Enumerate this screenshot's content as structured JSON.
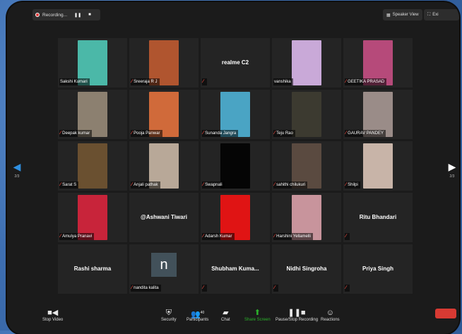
{
  "recording": {
    "label": "Recording...",
    "pause_icon": "pause-icon",
    "stop_icon": "stop-icon"
  },
  "view": {
    "speaker_view": "Speaker View",
    "exit": "Exi"
  },
  "pager": {
    "page": "2/3"
  },
  "tiles": [
    {
      "name": "Sakshi Kumari",
      "muted": false,
      "kind": "video",
      "color": "#4bb8a8"
    },
    {
      "name": "Sreeraja R J",
      "muted": true,
      "kind": "video",
      "color": "#b0552f"
    },
    {
      "name": "",
      "display": "realme C2",
      "muted": true,
      "kind": "text"
    },
    {
      "name": "vanshika",
      "muted": false,
      "kind": "video",
      "color": "#c9a9d8"
    },
    {
      "name": "GEETIKA PRASAD",
      "muted": true,
      "kind": "video",
      "color": "#b64a7a"
    },
    {
      "name": "Deepak kumar",
      "muted": true,
      "kind": "video",
      "color": "#8c8070"
    },
    {
      "name": "Pooja Panwar",
      "muted": true,
      "kind": "video",
      "color": "#d06a3a"
    },
    {
      "name": "Sunanda Jangra",
      "muted": true,
      "kind": "video",
      "color": "#4aa4c4"
    },
    {
      "name": "Teju Rao",
      "muted": true,
      "kind": "video",
      "color": "#3c3a30"
    },
    {
      "name": "GAURAV PANDEY",
      "muted": true,
      "kind": "video",
      "color": "#9a8c88"
    },
    {
      "name": "Sarat S",
      "muted": true,
      "kind": "video",
      "color": "#6a5030"
    },
    {
      "name": "Anjali pathak",
      "muted": true,
      "kind": "video",
      "color": "#b8a898"
    },
    {
      "name": "Swapnali",
      "muted": true,
      "kind": "video",
      "color": "#050505"
    },
    {
      "name": "sahithi chilukuri",
      "muted": true,
      "kind": "video",
      "color": "#5a4a40"
    },
    {
      "name": "Shilpi",
      "muted": true,
      "kind": "video",
      "color": "#c8b4a8"
    },
    {
      "name": "Amulya Pranavi",
      "muted": true,
      "kind": "video",
      "color": "#c8243a"
    },
    {
      "name": "",
      "display": "@Ashwani Tiwari",
      "muted": false,
      "kind": "text"
    },
    {
      "name": "Adarsh Kumar",
      "muted": true,
      "kind": "video",
      "color": "#e01414"
    },
    {
      "name": "Harshini Yellamelli",
      "muted": true,
      "kind": "video",
      "color": "#c8949c"
    },
    {
      "name": "",
      "display": "Ritu Bhandari",
      "muted": true,
      "kind": "text"
    },
    {
      "name": "",
      "display": "Rashi sharma",
      "muted": false,
      "kind": "text"
    },
    {
      "name": "nandita kalita",
      "muted": true,
      "kind": "letter",
      "letter": "n"
    },
    {
      "name": "",
      "display": "Shubham  Kuma...",
      "muted": true,
      "kind": "text"
    },
    {
      "name": "",
      "display": "Nidhi Singroha",
      "muted": true,
      "kind": "text"
    },
    {
      "name": "",
      "display": "Priya Singh",
      "muted": true,
      "kind": "text"
    }
  ],
  "toolbar": {
    "stop_video": "Stop Video",
    "security": "Security",
    "participants": "Participants",
    "participants_count": "40",
    "chat": "Chat",
    "share_screen": "Share Screen",
    "record": "Pause/Stop Recording",
    "reactions": "Reactions"
  },
  "colors": {
    "accent_green": "#2bb32b",
    "muted_red": "#e5483e",
    "end_red": "#d73a33"
  }
}
